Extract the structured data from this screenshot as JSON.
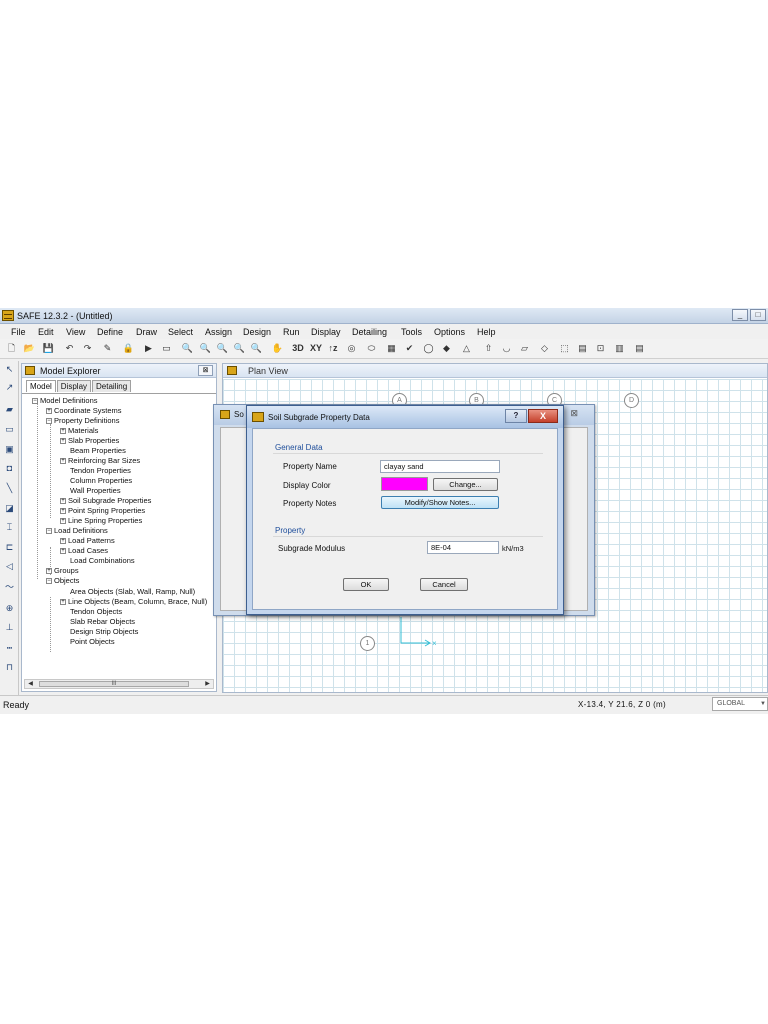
{
  "window": {
    "title": "SAFE 12.3.2 - (Untitled)",
    "min": "_",
    "max": "□"
  },
  "menu": [
    "File",
    "Edit",
    "View",
    "Define",
    "Draw",
    "Select",
    "Assign",
    "Design",
    "Run",
    "Display",
    "Detailing",
    "Tools",
    "Options",
    "Help"
  ],
  "toolbar": {
    "label_3d": "3D",
    "label_xy": "XY",
    "label_tz": "↑z"
  },
  "explorer": {
    "title": "Model Explorer",
    "close": "⊠",
    "tabs": [
      "Model",
      "Display",
      "Detailing"
    ],
    "tree": [
      "Model Definitions",
      "Coordinate Systems",
      "Property Definitions",
      "Materials",
      "Slab Properties",
      "Beam Properties",
      "Reinforcing Bar Sizes",
      "Tendon Properties",
      "Column Properties",
      "Wall Properties",
      "Soil Subgrade Properties",
      "Point Spring Properties",
      "Line Spring Properties",
      "Load Definitions",
      "Load Patterns",
      "Load Cases",
      "Load Combinations",
      "Groups",
      "Objects",
      "Area Objects (Slab, Wall, Ramp, Null)",
      "Line Objects (Beam, Column, Brace, Null)",
      "Tendon Objects",
      "Slab Rebar Objects",
      "Design Strip Objects",
      "Point Objects"
    ],
    "scroll_thumb": "III"
  },
  "planview": {
    "title": "Plan View",
    "grid_bubbles": [
      "A",
      "B",
      "C",
      "D"
    ],
    "row_bubble": "1"
  },
  "bg_dialog": {
    "title": "So",
    "close": "⊠"
  },
  "dialog": {
    "title": "Soil Subgrade Property Data",
    "help": "?",
    "close": "X",
    "general_group": "General Data",
    "property_name_label": "Property Name",
    "property_name_value": "clayay sand",
    "display_color_label": "Display Color",
    "display_color": "#ff00ff",
    "change_button": "Change...",
    "property_notes_label": "Property Notes",
    "notes_button": "Modify/Show Notes...",
    "property_group": "Property",
    "subgrade_label": "Subgrade Modulus",
    "subgrade_value": "8E-04",
    "subgrade_unit": "kN/m3",
    "ok": "OK",
    "cancel": "Cancel"
  },
  "status": {
    "left": "Ready",
    "coords": "X-13.4, Y 21.6, Z 0  (m)",
    "coord_system": "GLOBAL"
  }
}
